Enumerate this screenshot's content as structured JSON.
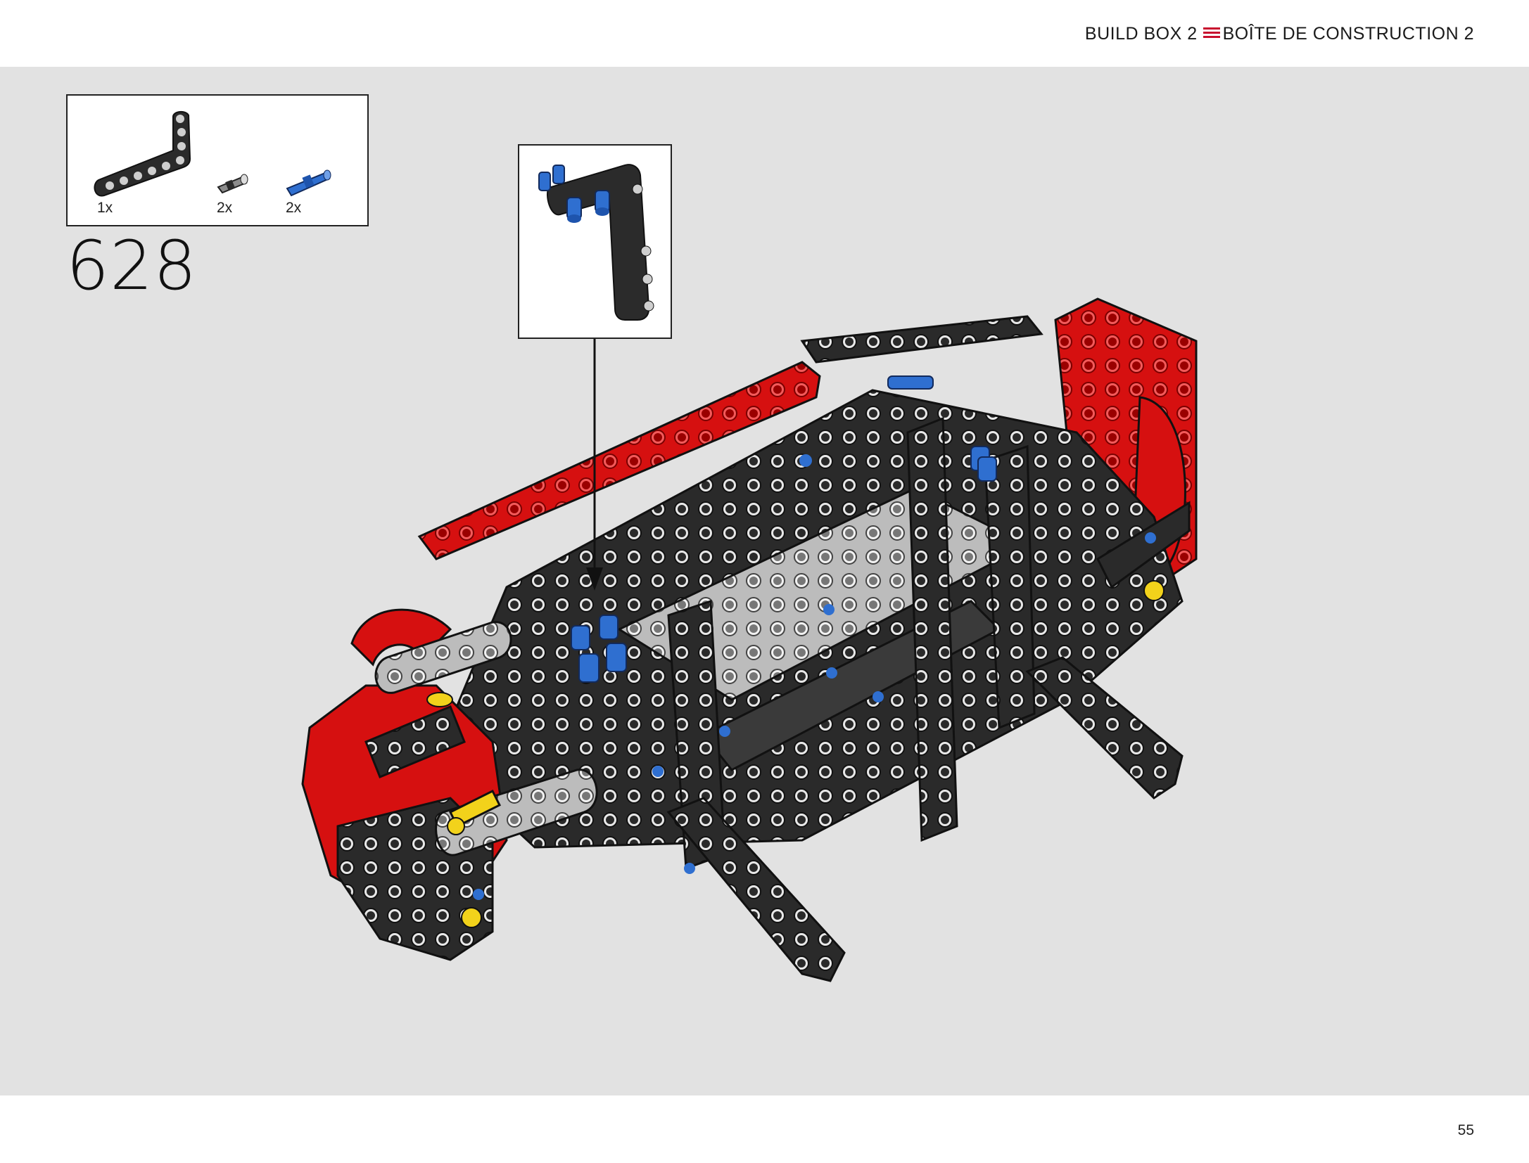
{
  "header": {
    "build_box": "BUILD BOX 2",
    "build_box_fr": "BOÎTE DE CONSTRUCTION 2",
    "separator_icon": "triple-line-icon",
    "accent_color": "#c8102e"
  },
  "parts": [
    {
      "quantity": "1x",
      "icon": "bent-liftarm-icon",
      "color": "#2b2b2b"
    },
    {
      "quantity": "2x",
      "icon": "gray-pin-icon",
      "color": "#9a9a9a"
    },
    {
      "quantity": "2x",
      "icon": "blue-axle-pin-icon",
      "color": "#2f6fd0"
    }
  ],
  "step": {
    "number": "628"
  },
  "callout": {
    "icon": "subassembly-liftarm-with-blue-pins-icon"
  },
  "model": {
    "icon": "technic-chassis-assembly-icon",
    "colors": {
      "red": "#d61010",
      "black": "#2a2a2a",
      "gray": "#b9b9b9",
      "blue": "#2f6fd0",
      "yellow": "#f2d21b"
    }
  },
  "footer": {
    "page_number": "55"
  }
}
